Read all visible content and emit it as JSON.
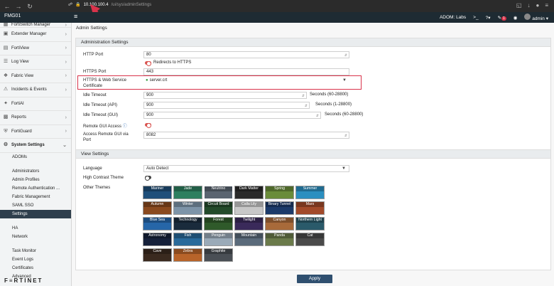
{
  "browser": {
    "host": "10.100.100.4",
    "path": "/ui/sys/adminSettings"
  },
  "header": {
    "device": "FMG01",
    "adom": "ADOM: Labs",
    "notif_count": "1",
    "user": "admin"
  },
  "sidebar": {
    "items": [
      {
        "label": "FortiSwitch Manager",
        "icon": "switch-icon"
      },
      {
        "label": "Extender Manager",
        "icon": "extender-icon"
      },
      {
        "label": "FortiView",
        "icon": "chart-icon"
      },
      {
        "label": "Log View",
        "icon": "log-icon"
      },
      {
        "label": "Fabric View",
        "icon": "fabric-icon"
      },
      {
        "label": "Incidents & Events",
        "icon": "bell-icon"
      },
      {
        "label": "FortiAI",
        "icon": "ai-icon"
      },
      {
        "label": "Reports",
        "icon": "reports-icon"
      },
      {
        "label": "FortiGuard",
        "icon": "shield-icon"
      },
      {
        "label": "System Settings",
        "icon": "gear-icon"
      }
    ],
    "sub": [
      "ADOMs",
      "Administrators",
      "Admin Profiles",
      "Remote Authentication ...",
      "Fabric Management",
      "SAML SSO",
      "Settings",
      "HA",
      "Network",
      "Task Monitor",
      "Event Logs",
      "Certificates",
      "Advanced"
    ],
    "logo": "F≡RTINET"
  },
  "main": {
    "breadcrumb": "Admin Settings",
    "admin_section": "Administration Settings",
    "view_section": "View Settings",
    "apply": "Apply"
  },
  "admin": {
    "http_port_label": "HTTP Port",
    "http_port": "80",
    "redirect_label": "Redirects to HTTPS",
    "https_port_label": "HTTPS Port",
    "https_port": "443",
    "cert_label": "HTTPS & Web Service Certificate",
    "cert_value": "server.crt",
    "idle_label": "Idle Timeout",
    "idle_value": "900",
    "idle_unit": "Seconds (60-28800)",
    "idle_api_label": "Idle Timeout (API)",
    "idle_api_value": "900",
    "idle_api_unit": "Seconds (1-28800)",
    "idle_gui_label": "Idle Timeout (GUI)",
    "idle_gui_value": "900",
    "idle_gui_unit": "Seconds (60-28800)",
    "remote_gui_label": "Remote GUI Access",
    "remote_port_label": "Access Remote GUI via Port",
    "remote_port": "8082"
  },
  "view": {
    "language_label": "Language",
    "language_value": "Auto Detect",
    "contrast_label": "High Contrast Theme",
    "themes_label": "Other Themes",
    "themes": [
      {
        "name": "Mariner",
        "color": "#1f4f7a"
      },
      {
        "name": "Jade",
        "color": "#2e7f5f"
      },
      {
        "name": "Neutrino",
        "color": "#5a6470"
      },
      {
        "name": "Dark Matter",
        "color": "#2a2a2a"
      },
      {
        "name": "Spring",
        "color": "#6a8c3a"
      },
      {
        "name": "Summer",
        "color": "#2b8fc0"
      },
      {
        "name": "Autumn",
        "color": "#8a4a1f"
      },
      {
        "name": "Winter",
        "color": "#7d94a8"
      },
      {
        "name": "Circuit Board",
        "color": "#234a2a"
      },
      {
        "name": "Calla Lily",
        "color": "#c8c8c8"
      },
      {
        "name": "Binary Tunnel",
        "color": "#1b3a6a"
      },
      {
        "name": "Mars",
        "color": "#a24a2a"
      },
      {
        "name": "Blue Sea",
        "color": "#2666a8"
      },
      {
        "name": "Technology",
        "color": "#1a2b3c"
      },
      {
        "name": "Forest",
        "color": "#2f5a2a"
      },
      {
        "name": "Twilight",
        "color": "#3a2a5a"
      },
      {
        "name": "Canyon",
        "color": "#a86a3a"
      },
      {
        "name": "Northern Light",
        "color": "#2a5a6a"
      },
      {
        "name": "Astronomy",
        "color": "#15203a"
      },
      {
        "name": "Fish",
        "color": "#2a6a9a"
      },
      {
        "name": "Penguin",
        "color": "#9aaab8"
      },
      {
        "name": "Mountain",
        "color": "#5a6a7a"
      },
      {
        "name": "Panda",
        "color": "#6a7a4a"
      },
      {
        "name": "Cat",
        "color": "#4a4a4a"
      },
      {
        "name": "Cave",
        "color": "#3a2a1f"
      },
      {
        "name": "Zebra",
        "color": "#b8642a"
      },
      {
        "name": "Graphite",
        "color": "#4a4f55"
      }
    ]
  }
}
